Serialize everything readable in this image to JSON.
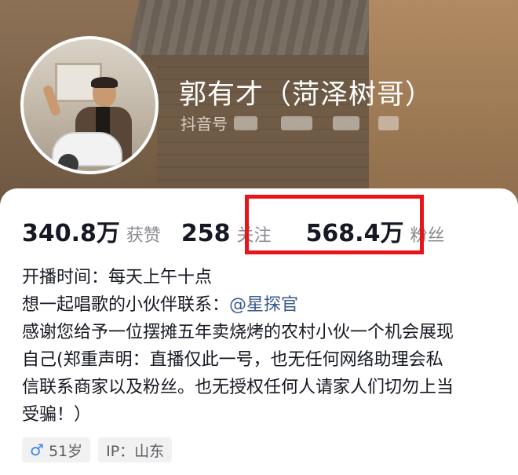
{
  "profile": {
    "name": "郭有才（菏泽树哥）",
    "id_label": "抖音号"
  },
  "stats": [
    {
      "value": "340.8万",
      "label": "获赞"
    },
    {
      "value": "258",
      "label": "关注"
    },
    {
      "value": "568.4万",
      "label": "粉丝"
    }
  ],
  "bio": {
    "line1": "开播时间：每天上午十点",
    "line2_prefix": "想一起唱歌的小伙伴联系：",
    "line2_mention": "@星探官",
    "line3": "感谢您给予一位摆摊五年卖烧烤的农村小伙一个机会展现",
    "line4": "自己(郑重声明：直播仅此一号，也无任何网络助理会私",
    "line5": "信联系商家以及粉丝。也无授权任何人请家人们切勿上当",
    "line6": "受骗！）"
  },
  "tags": {
    "gender_icon": "male-icon",
    "age": "51岁",
    "ip": "IP：山东"
  },
  "colors": {
    "highlight": "#e8141a",
    "mention": "#3a5a8c",
    "male": "#3b82e6"
  }
}
